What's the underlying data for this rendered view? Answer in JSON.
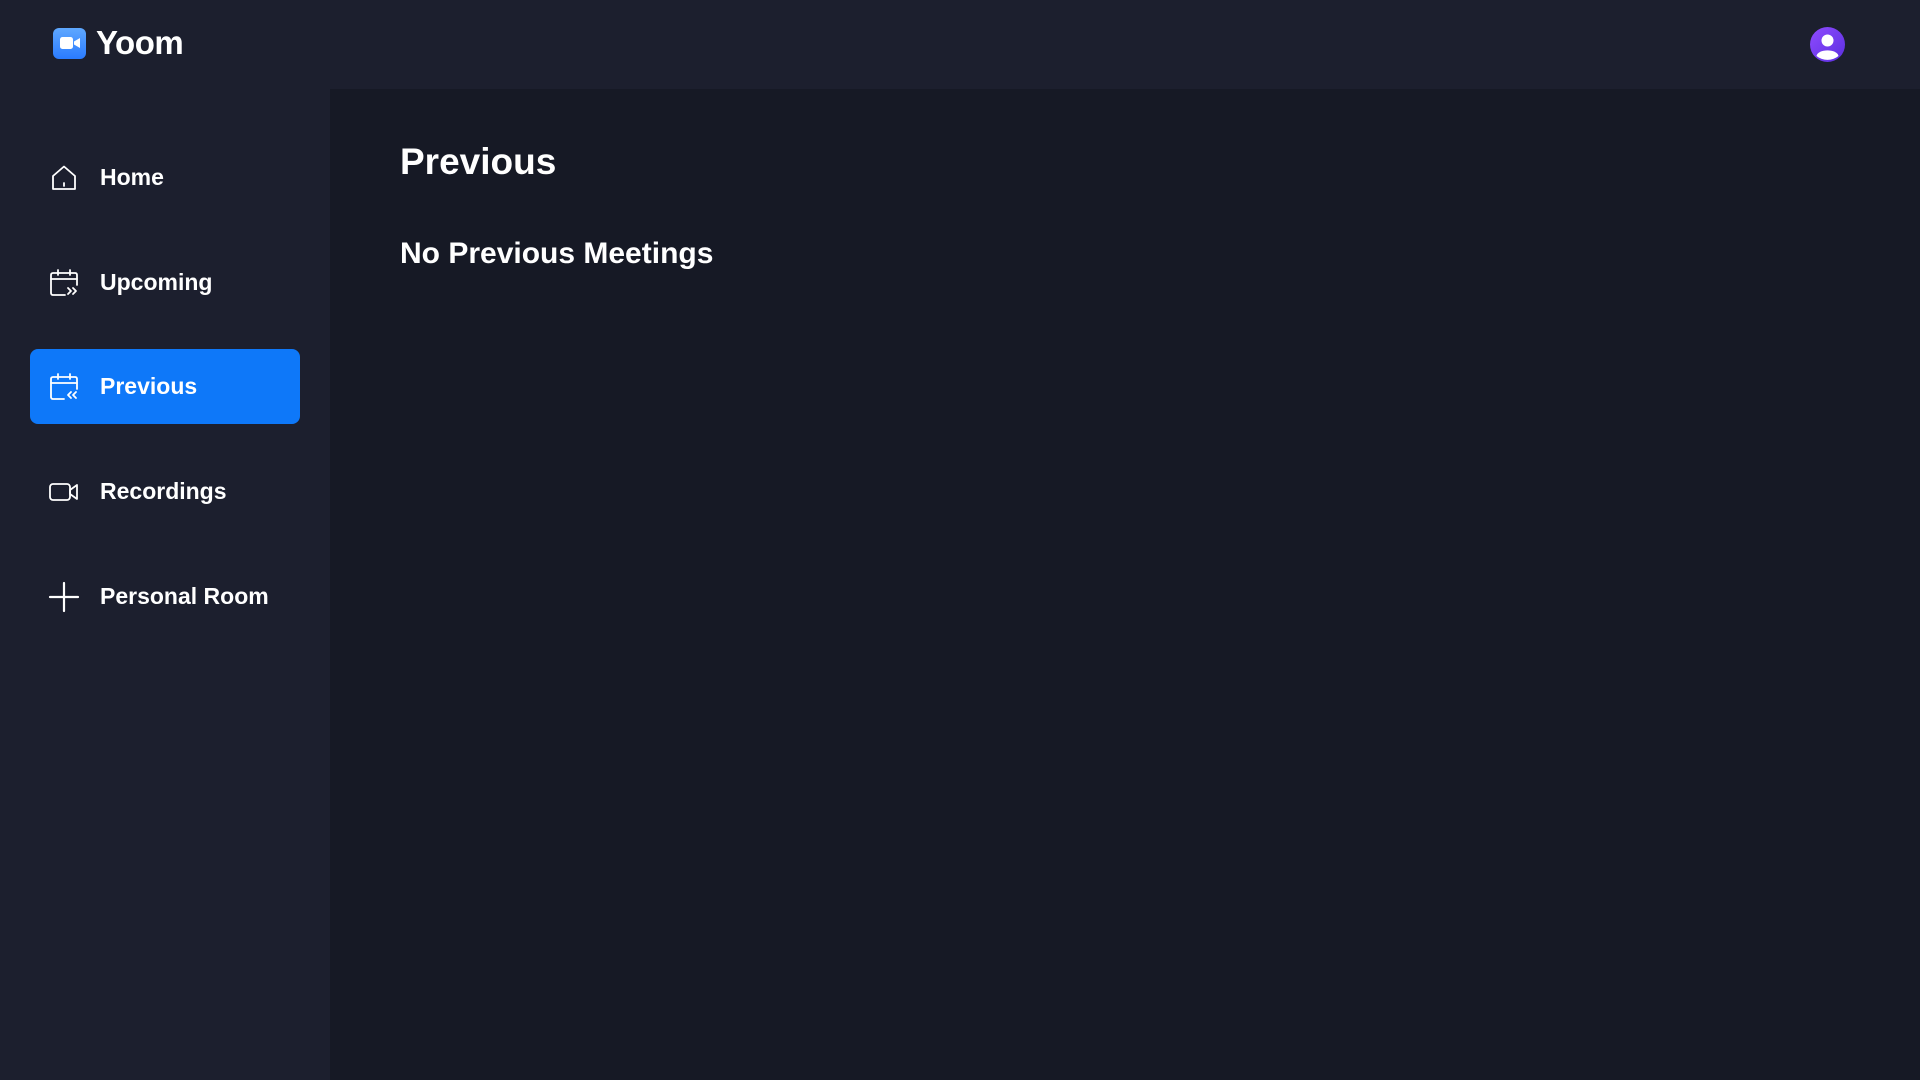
{
  "header": {
    "brand": "Yoom",
    "brand_icon": "video-camera-icon",
    "avatar_icon": "user-avatar-icon"
  },
  "sidebar": {
    "items": [
      {
        "label": "Home",
        "icon": "home-icon",
        "active": false
      },
      {
        "label": "Upcoming",
        "icon": "calendar-forward-icon",
        "active": false
      },
      {
        "label": "Previous",
        "icon": "calendar-back-icon",
        "active": true
      },
      {
        "label": "Recordings",
        "icon": "video-icon",
        "active": false
      },
      {
        "label": "Personal Room",
        "icon": "plus-icon",
        "active": false
      }
    ]
  },
  "main": {
    "title": "Previous",
    "empty_message": "No Previous Meetings"
  },
  "colors": {
    "accent": "#0e78f9",
    "sidebar_bg": "#1c1f2e",
    "main_bg": "#161925",
    "avatar": "#7a3cf5"
  }
}
